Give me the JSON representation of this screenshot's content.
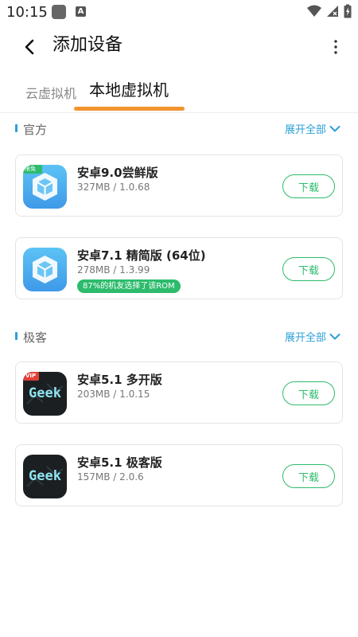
{
  "status_bar": {
    "time": "10:15",
    "a_badge": "A",
    "icons": [
      "notification-square-icon",
      "a-badge-icon",
      "wifi-icon",
      "signal-icon",
      "battery-charging-icon"
    ]
  },
  "header": {
    "title": "添加设备",
    "back_icon": "back-arrow-icon",
    "more_icon": "more-vert-icon"
  },
  "tabs": [
    {
      "label": "云虚拟机",
      "active": false
    },
    {
      "label": "本地虚拟机",
      "active": true
    }
  ],
  "accent_color": "#f29430",
  "link_color": "#2a9fd6",
  "button_color": "#2dbb6c",
  "sections": [
    {
      "title": "官方",
      "expand_label": "展开全部",
      "items": [
        {
          "name": "安卓9.0尝鲜版",
          "meta": "327MB / 1.0.68",
          "button": "下载",
          "icon": "vm-cube-icon",
          "corner_tag": "限免"
        },
        {
          "name": "安卓7.1 精简版 (64位)",
          "meta": "278MB / 1.3.99",
          "button": "下载",
          "icon": "vm-cube-icon",
          "badge": "87%的机友选择了该ROM"
        }
      ]
    },
    {
      "title": "极客",
      "expand_label": "展开全部",
      "items": [
        {
          "name": "安卓5.1 多开版",
          "meta": "203MB / 1.0.15",
          "button": "下载",
          "icon": "geek-logo-icon",
          "corner_tag": "VIP",
          "icon_text": "Geek"
        },
        {
          "name": "安卓5.1 极客版",
          "meta": "157MB / 2.0.6",
          "button": "下载",
          "icon": "geek-logo-icon",
          "icon_text": "Geek"
        }
      ]
    }
  ]
}
